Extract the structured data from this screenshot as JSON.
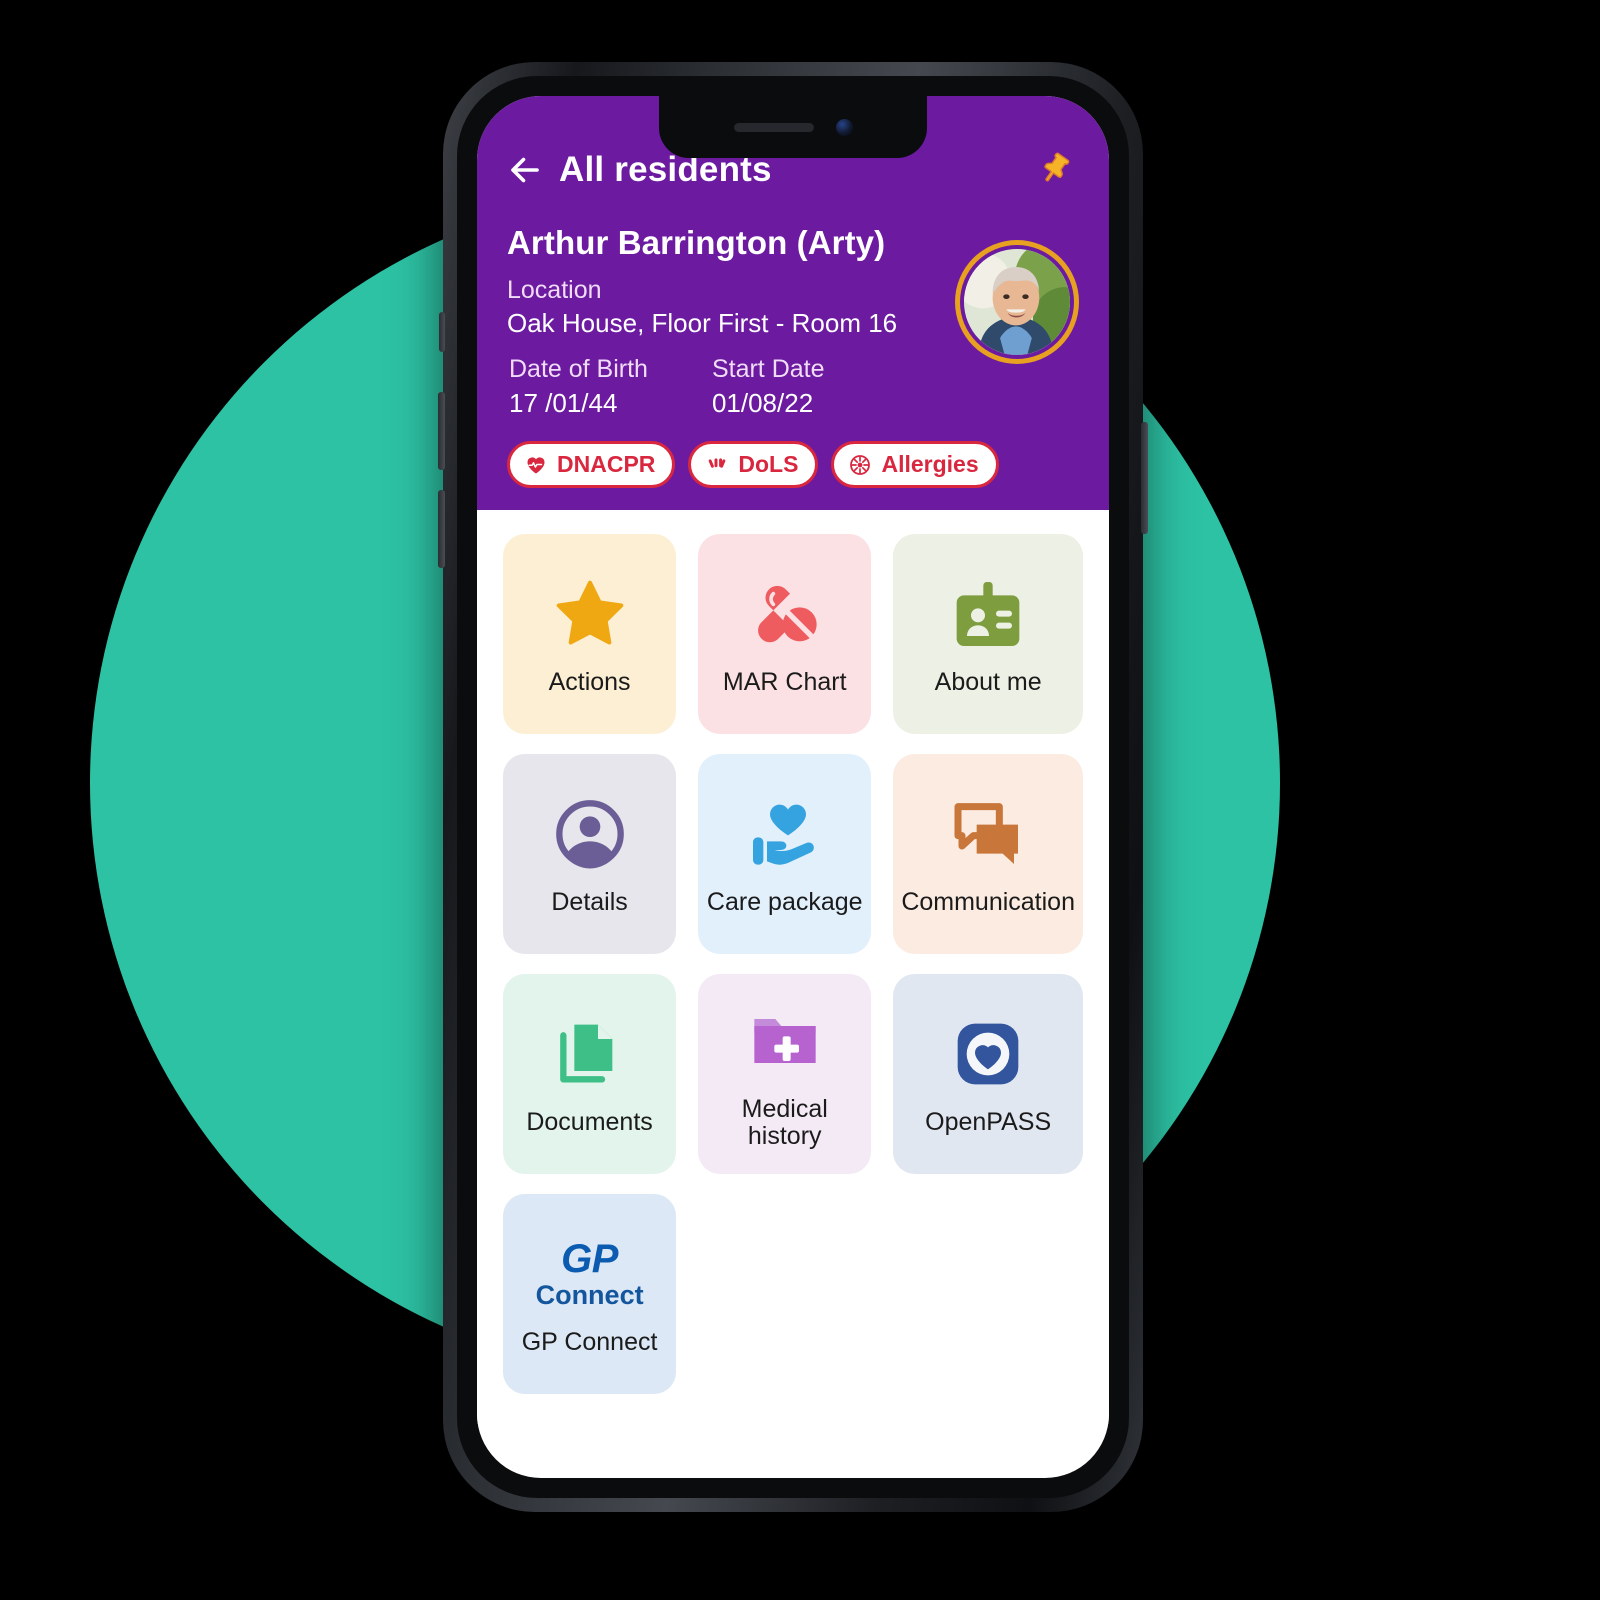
{
  "theme": {
    "brand_purple": "#6C1AA0",
    "bg_teal": "#2DC2A4",
    "badge_red": "#D8273F",
    "avatar_ring": "#E8A020"
  },
  "header": {
    "back_icon": "back-arrow-icon",
    "nav_title": "All residents",
    "pin_icon": "pin-icon",
    "resident_name": "Arthur Barrington (Arty)",
    "location_label": "Location",
    "location_value": "Oak House, Floor First - Room 16",
    "dob_label": "Date of Birth",
    "dob_value": "17 /01/44",
    "start_label": "Start Date",
    "start_value": "01/08/22",
    "badges": [
      {
        "label": "DNACPR",
        "icon": "heart-pulse-icon"
      },
      {
        "label": "DoLS",
        "icon": "hands-icon"
      },
      {
        "label": "Allergies",
        "icon": "allergy-icon"
      }
    ]
  },
  "tiles": [
    {
      "label": "Actions",
      "icon": "star-icon",
      "bg": "#FCEFD4",
      "color": "#EFA811"
    },
    {
      "label": "MAR Chart",
      "icon": "pills-icon",
      "bg": "#FBE1E4",
      "color": "#EF5C5F"
    },
    {
      "label": "About me",
      "icon": "id-badge-icon",
      "bg": "#EDF0E4",
      "color": "#7E9D3E"
    },
    {
      "label": "Details",
      "icon": "user-circle-icon",
      "bg": "#E7E6EC",
      "color": "#6B5E96"
    },
    {
      "label": "Care package",
      "icon": "hand-heart-icon",
      "bg": "#E2F0FC",
      "color": "#35A3DF"
    },
    {
      "label": "Communication",
      "icon": "chat-icon",
      "bg": "#FBEBE1",
      "color": "#C9763A"
    },
    {
      "label": "Documents",
      "icon": "documents-icon",
      "bg": "#E2F4EB",
      "color": "#3FBF88"
    },
    {
      "label": "Medical history",
      "icon": "folder-plus-icon",
      "bg": "#F4EAF5",
      "color": "#B763CF"
    },
    {
      "label": "OpenPASS",
      "icon": "openpass-icon",
      "bg": "#E1E7F1",
      "color": "#32559E"
    },
    {
      "label": "GP Connect",
      "icon": "gp-connect-logo",
      "bg": "#DCE8F5",
      "color": "#0B5CB0"
    }
  ],
  "gp_connect_logo": {
    "line1": "GP",
    "line2": "Connect"
  }
}
